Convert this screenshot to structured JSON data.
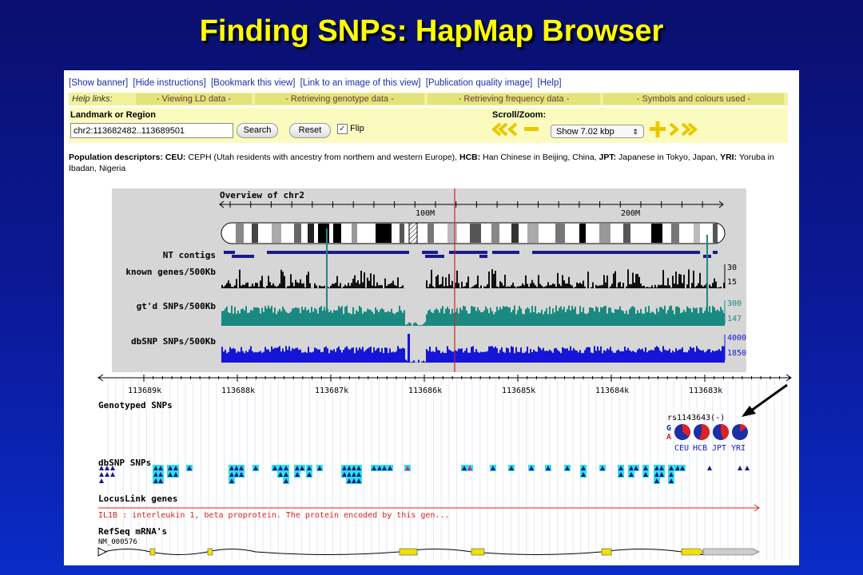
{
  "slide_title": "Finding SNPs:  HapMap Browser",
  "top_links": [
    "[Show banner]",
    "[Hide instructions]",
    "[Bookmark this view]",
    "[Link to an image of this view]",
    "[Publication quality image]",
    "[Help]"
  ],
  "help": {
    "label": "Help links:",
    "links": [
      "- Viewing LD data -",
      "- Retrieving genotype data -",
      "- Retrieving frequency data -",
      "- Symbols and colours used -"
    ]
  },
  "form": {
    "landmark_label": "Landmark or Region",
    "region_value": "chr2:113682482..113689501",
    "search_label": "Search",
    "reset_label": "Reset",
    "flip_label": "Flip",
    "flip_checked": "✓",
    "scroll_label": "Scroll/Zoom:",
    "zoom_value": "Show 7.02 kbp"
  },
  "population": {
    "lead": "Population descriptors:",
    "ceu_code": "CEU:",
    "ceu_text": " CEPH (Utah residents with ancestry from northern and western Europe), ",
    "hcb_code": "HCB:",
    "hcb_text": " Han Chinese in Beijing, China, ",
    "jpt_code": "JPT:",
    "jpt_text": " Japanese in Tokyo, Japan, ",
    "yri_code": "YRI:",
    "yri_text": " Yoruba in Ibadan, Nigeria"
  },
  "overview": {
    "title": "Overview of chr2",
    "ticks": [
      "100M",
      "200M"
    ],
    "tracks": [
      "NT contigs",
      "known genes/500Kb",
      "gt'd SNPs/500Kb",
      "dbSNP SNPs/500Kb"
    ],
    "scales": {
      "genes": [
        "30",
        "15"
      ],
      "gtd": [
        "300",
        "147"
      ],
      "dbsnp": [
        "4000",
        "1850"
      ]
    },
    "colors": {
      "genes": "#111111",
      "gtd": "#1a8a80",
      "dbsnp": "#1515d8",
      "contigs": "#1a1a8c",
      "cursor": "#e02020"
    }
  },
  "detail": {
    "ticks": [
      "113689k",
      "113688k",
      "113687k",
      "113686k",
      "113685k",
      "113684k",
      "113683k"
    ],
    "genotyped_label": "Genotyped SNPs",
    "snp_id": "rs1143643(-)",
    "allele_top": "G",
    "allele_bottom": "A",
    "pops": [
      "CEU",
      "HCB",
      "JPT",
      "YRI"
    ],
    "dbsnp_label": "dbSNP SNPs",
    "locuslink_label": "LocusLink genes",
    "locuslink_text": "IL1B : interleukin 1, beta proprotein. The protein encoded by this gen...",
    "refseq_label": "RefSeq mRNA's",
    "refseq_id": "NM_000576"
  }
}
